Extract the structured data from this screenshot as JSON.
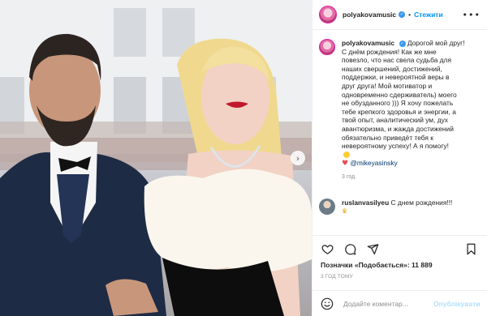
{
  "post": {
    "username": "polyakovamusic",
    "follow_label": "Стежити",
    "dot": "•",
    "more_label": "•••",
    "caption_lines": [
      "Дорогой мой друг!",
      "С днём рождения! Как же мне",
      "повезло, что нас свела судьба для",
      "наших свершений, достижений,",
      "поддержки, и невероятной веры в",
      "друг друга! Мой мотиватор и",
      "одновременно сдерживатель) моего",
      "не обузданного ))) Я хочу пожелать",
      "тебе крепкого здоровья и энергии, а",
      "твой опыт, аналитический ум, дух",
      "авантюризма, и жажда достижений",
      "обязательно приведёт тебя к",
      "невероятному успеху! А я помогу!"
    ],
    "mention": "@mikeyasinsky",
    "caption_time": "3 год.",
    "comment": {
      "username": "ruslanvasilyeu",
      "text": "С днем рождения!!!"
    },
    "likes_text": "Позначки «Подобається»: 11 889",
    "posted_ago": "3 ГОД ТОМУ",
    "add_comment_placeholder": "Додайте коментар...",
    "publish_label": "Опублікувати"
  },
  "colors": {
    "link": "#0095f6",
    "verified": "#3897f0",
    "heart": "#ed4956",
    "muted": "#8e8e8e"
  },
  "icons": [
    "verified-badge-icon",
    "more-options-icon",
    "heart-icon",
    "comment-icon",
    "share-icon",
    "bookmark-icon",
    "emoji-icon",
    "next-photo-icon"
  ]
}
